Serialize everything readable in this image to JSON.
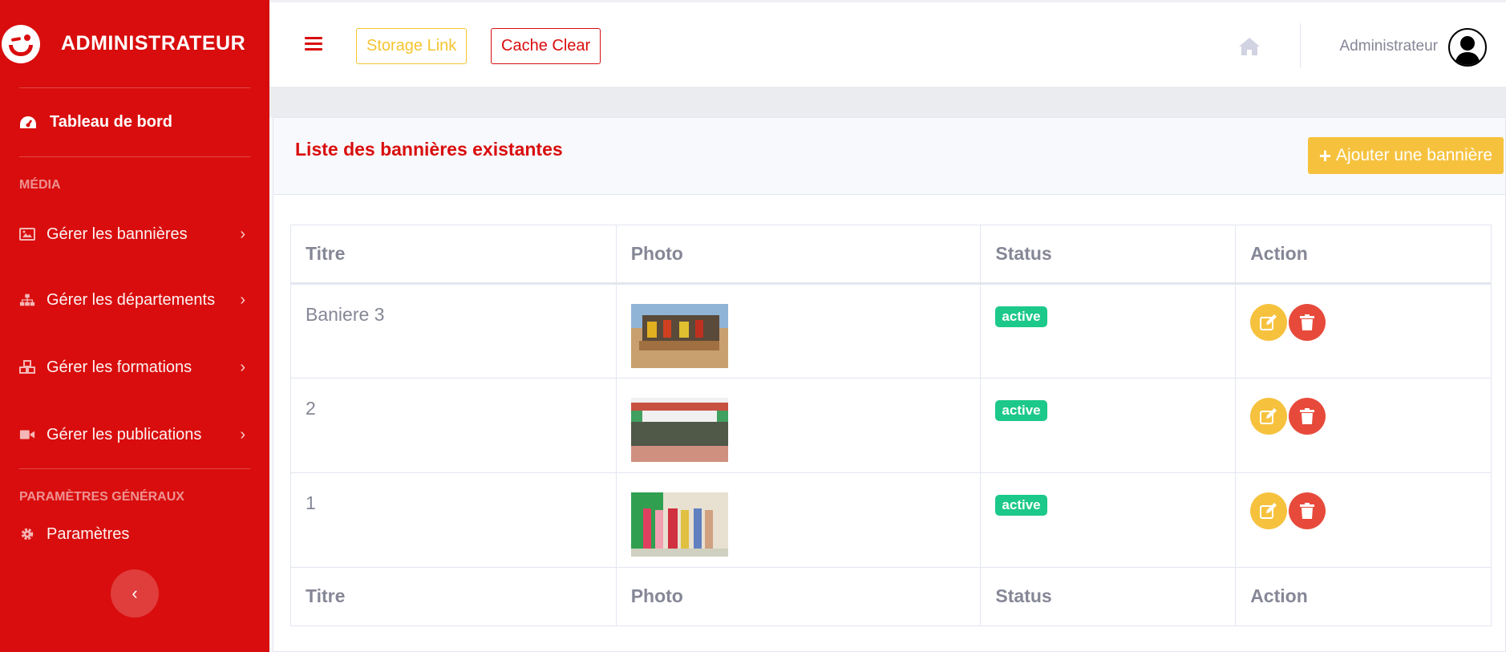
{
  "sidebar": {
    "brand": "ADMINISTRATEUR",
    "dashboard_label": "Tableau de bord",
    "section_media": "MÉDIA",
    "items": [
      {
        "label": "Gérer les bannières",
        "icon": "image-icon"
      },
      {
        "label": "Gérer les départements",
        "icon": "sitemap-icon"
      },
      {
        "label": "Gérer les formations",
        "icon": "cubes-icon"
      },
      {
        "label": "Gérer les publications",
        "icon": "video-icon"
      }
    ],
    "section_settings": "PARAMÈTRES GÉNÉRAUX",
    "settings_label": "Paramètres"
  },
  "topbar": {
    "storage_link": "Storage Link",
    "cache_clear": "Cache Clear",
    "user_name": "Administrateur"
  },
  "card": {
    "title": "Liste des bannières existantes",
    "add_button": "Ajouter une bannière"
  },
  "table": {
    "headers": [
      "Titre",
      "Photo",
      "Status",
      "Action"
    ],
    "rows": [
      {
        "titre": "Baniere 3",
        "status": "active"
      },
      {
        "titre": "2",
        "status": "active"
      },
      {
        "titre": "1",
        "status": "active"
      }
    ]
  },
  "colors": {
    "primary": "#d90d0d",
    "warning": "#f6c23e",
    "success": "#1cc88a",
    "danger": "#e74a3b"
  }
}
